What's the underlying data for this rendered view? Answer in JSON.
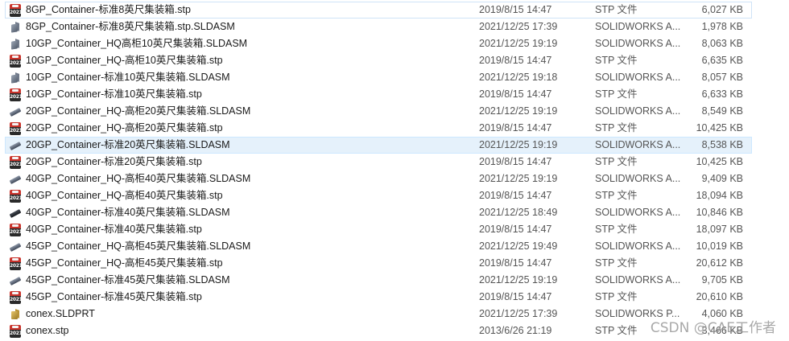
{
  "files": [
    {
      "icon": "stp",
      "name": "8GP_Container-标准8英尺集装箱.stp",
      "date": "2019/8/15 14:47",
      "type": "STP 文件",
      "size": "6,027 KB"
    },
    {
      "icon": "asm",
      "name": "8GP_Container-标准8英尺集装箱.stp.SLDASM",
      "date": "2021/12/25 17:39",
      "type": "SOLIDWORKS A...",
      "size": "1,978 KB"
    },
    {
      "icon": "asm",
      "name": "10GP_Container_HQ高柜10英尺集装箱.SLDASM",
      "date": "2021/12/25 19:19",
      "type": "SOLIDWORKS A...",
      "size": "8,063 KB"
    },
    {
      "icon": "stp",
      "name": "10GP_Container_HQ-高柜10英尺集装箱.stp",
      "date": "2019/8/15 14:47",
      "type": "STP 文件",
      "size": "6,635 KB"
    },
    {
      "icon": "asm",
      "name": "10GP_Container-标准10英尺集装箱.SLDASM",
      "date": "2021/12/25 19:18",
      "type": "SOLIDWORKS A...",
      "size": "8,057 KB"
    },
    {
      "icon": "stp",
      "name": "10GP_Container-标准10英尺集装箱.stp",
      "date": "2019/8/15 14:47",
      "type": "STP 文件",
      "size": "6,633 KB"
    },
    {
      "icon": "bar",
      "name": "20GP_Container_HQ-高柜20英尺集装箱.SLDASM",
      "date": "2021/12/25 19:19",
      "type": "SOLIDWORKS A...",
      "size": "8,549 KB"
    },
    {
      "icon": "stp",
      "name": "20GP_Container_HQ-高柜20英尺集装箱.stp",
      "date": "2019/8/15 14:47",
      "type": "STP 文件",
      "size": "10,425 KB"
    },
    {
      "icon": "bar",
      "name": "20GP_Container-标准20英尺集装箱.SLDASM",
      "date": "2021/12/25 19:19",
      "type": "SOLIDWORKS A...",
      "size": "8,538 KB",
      "selected": true
    },
    {
      "icon": "stp",
      "name": "20GP_Container-标准20英尺集装箱.stp",
      "date": "2019/8/15 14:47",
      "type": "STP 文件",
      "size": "10,425 KB"
    },
    {
      "icon": "bar",
      "name": "40GP_Container_HQ-高柜40英尺集装箱.SLDASM",
      "date": "2021/12/25 19:19",
      "type": "SOLIDWORKS A...",
      "size": "9,409 KB"
    },
    {
      "icon": "stp",
      "name": "40GP_Container_HQ-高柜40英尺集装箱.stp",
      "date": "2019/8/15 14:47",
      "type": "STP 文件",
      "size": "18,094 KB"
    },
    {
      "icon": "bardark",
      "name": "40GP_Container-标准40英尺集装箱.SLDASM",
      "date": "2021/12/25 18:49",
      "type": "SOLIDWORKS A...",
      "size": "10,846 KB"
    },
    {
      "icon": "stp",
      "name": "40GP_Container-标准40英尺集装箱.stp",
      "date": "2019/8/15 14:47",
      "type": "STP 文件",
      "size": "18,097 KB"
    },
    {
      "icon": "bar",
      "name": "45GP_Container_HQ-高柜45英尺集装箱.SLDASM",
      "date": "2021/12/25 19:49",
      "type": "SOLIDWORKS A...",
      "size": "10,019 KB"
    },
    {
      "icon": "stp",
      "name": "45GP_Container_HQ-高柜45英尺集装箱.stp",
      "date": "2019/8/15 14:47",
      "type": "STP 文件",
      "size": "20,612 KB"
    },
    {
      "icon": "bar",
      "name": "45GP_Container-标准45英尺集装箱.SLDASM",
      "date": "2021/12/25 19:19",
      "type": "SOLIDWORKS A...",
      "size": "9,705 KB"
    },
    {
      "icon": "stp",
      "name": "45GP_Container-标准45英尺集装箱.stp",
      "date": "2019/8/15 14:47",
      "type": "STP 文件",
      "size": "20,610 KB"
    },
    {
      "icon": "part",
      "name": "conex.SLDPRT",
      "date": "2021/12/25 17:39",
      "type": "SOLIDWORKS P...",
      "size": "4,060 KB"
    },
    {
      "icon": "stp",
      "name": "conex.stp",
      "date": "2013/6/26 21:19",
      "type": "STP 文件",
      "size": "3,466 KB"
    }
  ],
  "stp_icon_text": "2021",
  "watermark": "CSDN @CAE工作者"
}
